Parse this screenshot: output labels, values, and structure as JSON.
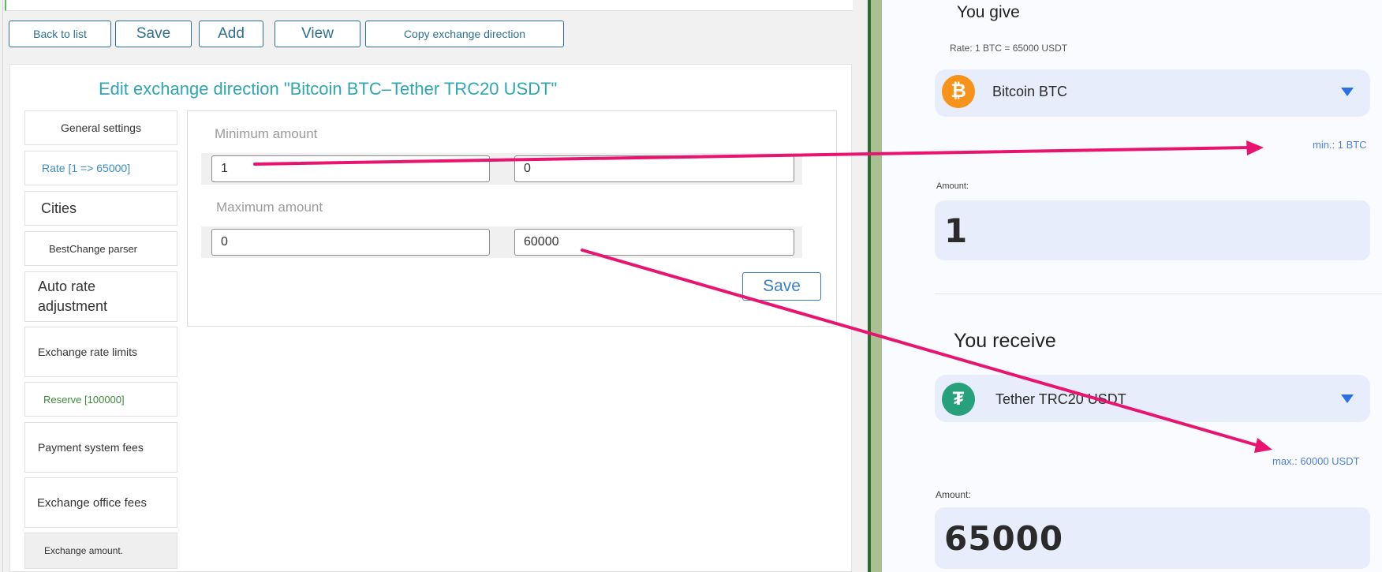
{
  "toolbar": {
    "back_label": "Back to list",
    "save_label": "Save",
    "add_label": "Add",
    "view_label": "View",
    "copy_label": "Copy exchange direction"
  },
  "page_title": "Edit exchange direction \"Bitcoin BTC–Tether TRC20 USDT\"",
  "tabs": [
    {
      "label": "General settings"
    },
    {
      "label": "Rate [1 => 65000]"
    },
    {
      "label": "Cities"
    },
    {
      "label": "BestChange parser"
    },
    {
      "label": "Auto rate adjustment"
    },
    {
      "label": "Exchange rate limits"
    },
    {
      "label": "Reserve [100000]"
    },
    {
      "label": "Payment system fees"
    },
    {
      "label": "Exchange office fees"
    },
    {
      "label": "Exchange amount."
    }
  ],
  "form": {
    "min_label": "Minimum amount",
    "min_give": "1",
    "min_receive": "0",
    "max_label": "Maximum amount",
    "max_give": "0",
    "max_receive": "60000",
    "save_label": "Save"
  },
  "widget": {
    "give_title": "You give",
    "rate_text": "Rate: 1 BTC = 65000 USDT",
    "give_currency": "Bitcoin BTC",
    "give_icon": "bitcoin-icon",
    "min_text": "min.: 1 BTC",
    "amount_label": "Amount:",
    "give_amount": "1",
    "receive_title": "You receive",
    "receive_currency": "Tether TRC20 USDT",
    "receive_icon": "tether-icon",
    "max_text": "max.: 60000 USDT",
    "receive_amount_label": "Amount:",
    "receive_amount": "65000"
  },
  "colors": {
    "accent_teal": "#2fa6b3",
    "button_blue": "#2f6f8f",
    "arrow_pink": "#e8146f",
    "bitcoin_orange": "#f7931a",
    "tether_green": "#26a17b",
    "link_blue": "#4f7fe0"
  }
}
